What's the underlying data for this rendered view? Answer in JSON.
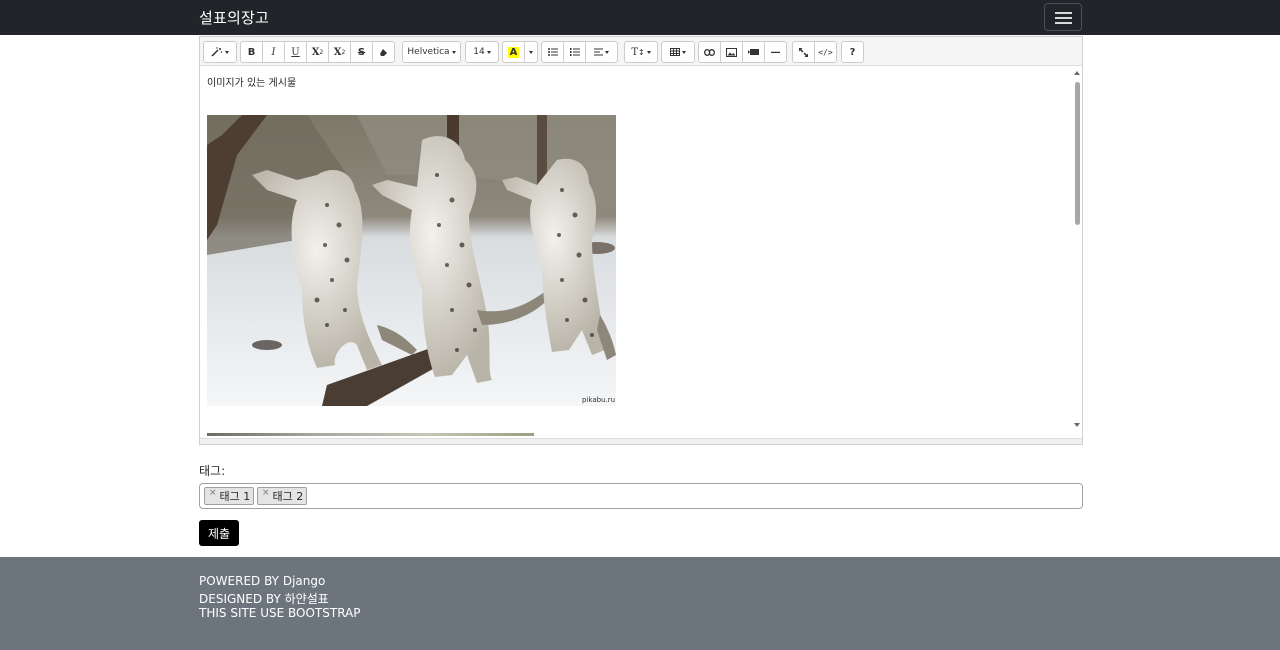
{
  "navbar": {
    "brand": "설표의장고",
    "toggler_icon": "hamburger-menu-icon"
  },
  "editor": {
    "toolbar": {
      "style_icon": "magic-wand-icon",
      "bold": "B",
      "italic": "I",
      "underline": "U",
      "superscript": "X",
      "subscript": "X",
      "strikethrough": "S",
      "eraser_icon": "eraser-icon",
      "font_name": "Helvetica",
      "font_size": "14",
      "color_button": "A",
      "ul_icon": "unordered-list-icon",
      "ol_icon": "ordered-list-icon",
      "align_icon": "align-left-icon",
      "height_label": "T",
      "table_icon": "table-icon",
      "link_icon": "link-icon",
      "picture_icon": "picture-icon",
      "video_icon": "video-icon",
      "hr_label": "—",
      "fullscreen_icon": "fullscreen-icon",
      "codeview_label": "</>",
      "help_label": "?",
      "highlight_color": "#ffff00"
    },
    "content": {
      "text": "이미지가 있는 게시물",
      "image": "snow-leopards-image",
      "watermark": "pikabu.ru"
    }
  },
  "tags": {
    "label": "태그:",
    "items": [
      "태그 1",
      "태그 2"
    ],
    "remove_symbol": "×"
  },
  "submit_label": "제출",
  "footer": {
    "line1": "POWERED BY Django",
    "line2": "DESIGNED BY 하얀설표",
    "line3": "THIS SITE USE BOOTSTRAP"
  },
  "colors": {
    "navbar": "#212529",
    "footer": "#6c757d",
    "submit": "#000000"
  }
}
